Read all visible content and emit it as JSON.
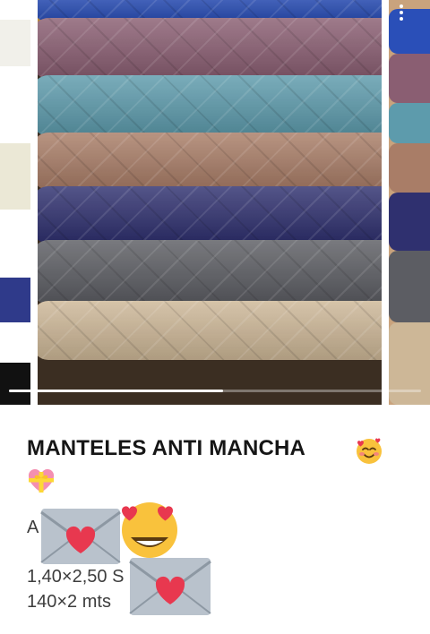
{
  "product": {
    "title": "MANTELES ANTI MANCHA",
    "line_a": "A",
    "size_1": "1,40×2,50 S",
    "size_2": "140×2 mts"
  },
  "carousel": {
    "progress": 0.52,
    "tablecloth_colors": [
      "#2a4fb8",
      "#8a5e72",
      "#5d9bac",
      "#a97d67",
      "#2f306f",
      "#5c5d63",
      "#cdb797"
    ]
  },
  "icons": [
    "cart-icon",
    "more-vert-icon",
    "back-arrow-icon",
    "smiling-face-with-hearts-icon",
    "heart-ribbon-icon",
    "love-letter-icon",
    "heart-eyes-icon"
  ],
  "colors": {
    "text": "#161616",
    "muted_text": "#3d3d3d"
  }
}
